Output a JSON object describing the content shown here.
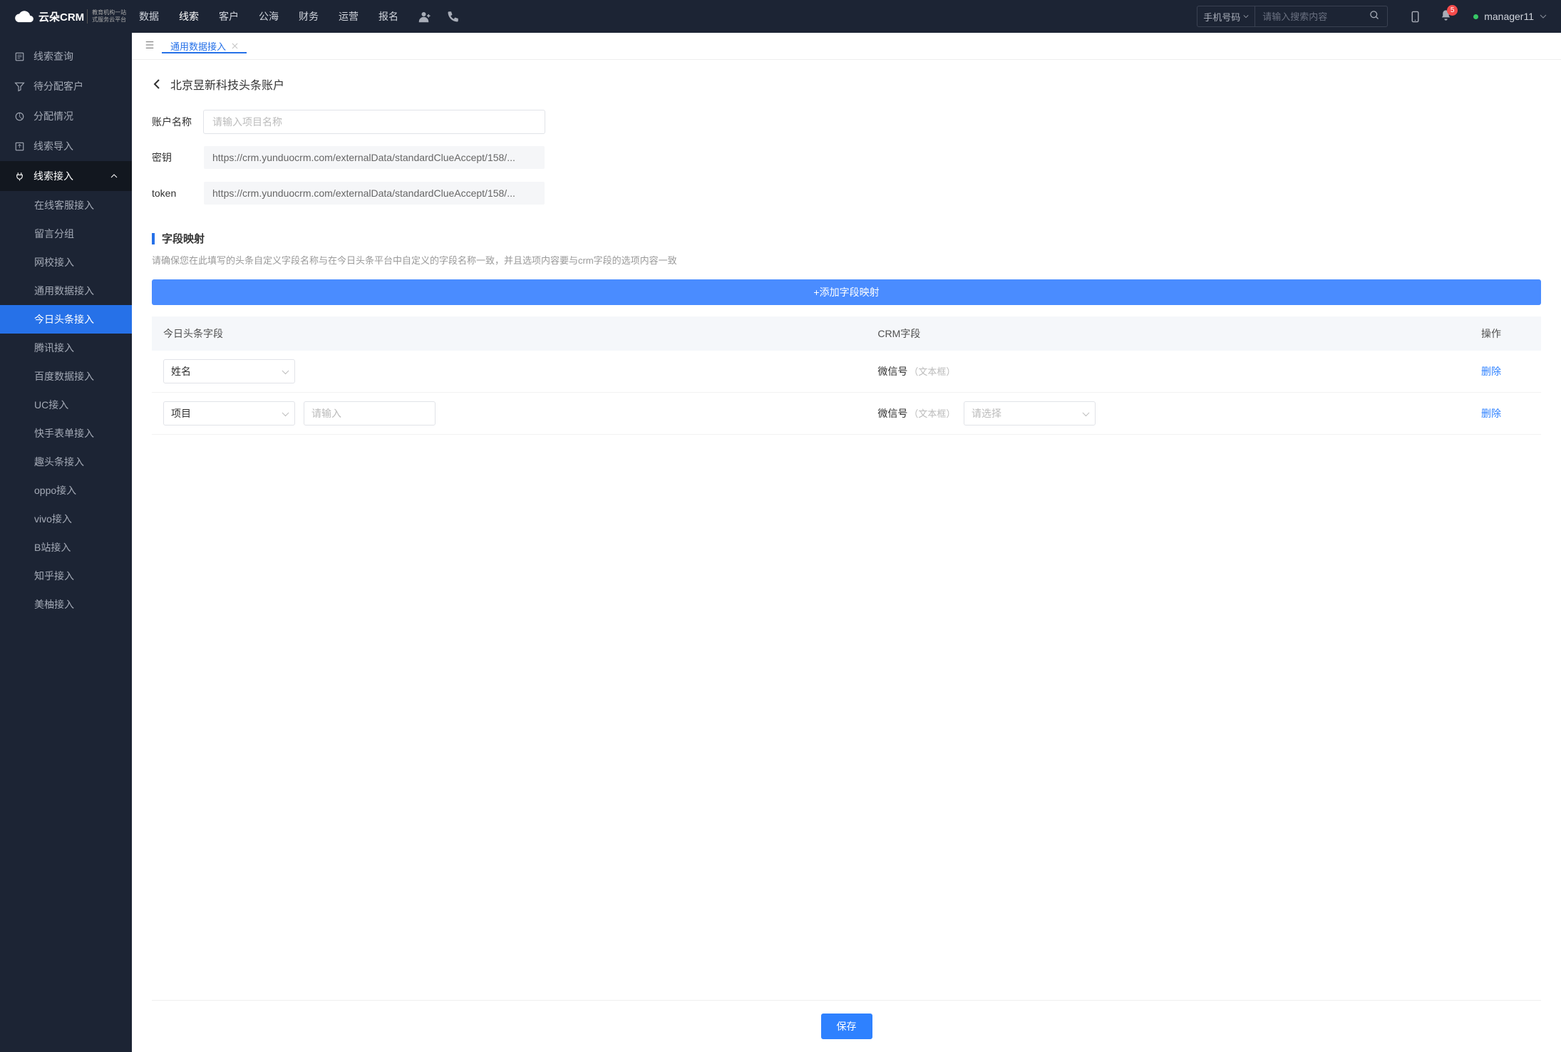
{
  "logo": {
    "brand": "云朵CRM",
    "sub1": "教育机构一站",
    "sub2": "式服务云平台"
  },
  "topNav": [
    "数据",
    "线索",
    "客户",
    "公海",
    "财务",
    "运营",
    "报名"
  ],
  "topNavActiveIndex": 1,
  "search": {
    "type": "手机号码",
    "placeholder": "请输入搜索内容"
  },
  "notifications": {
    "count": "5"
  },
  "user": {
    "name": "manager11"
  },
  "sidebar": {
    "items": [
      {
        "icon": "doc",
        "label": "线索查询"
      },
      {
        "icon": "filter",
        "label": "待分配客户"
      },
      {
        "icon": "pie",
        "label": "分配情况"
      },
      {
        "icon": "upload",
        "label": "线索导入"
      }
    ],
    "expanded": {
      "icon": "plug",
      "label": "线索接入"
    },
    "subItems": [
      "在线客服接入",
      "留言分组",
      "网校接入",
      "通用数据接入",
      "今日头条接入",
      "腾讯接入",
      "百度数据接入",
      "UC接入",
      "快手表单接入",
      "趣头条接入",
      "oppo接入",
      "vivo接入",
      "B站接入",
      "知乎接入",
      "美柚接入"
    ],
    "subActiveIndex": 4
  },
  "tabs": [
    {
      "label": "通用数据接入"
    }
  ],
  "tabActiveIndex": 0,
  "page": {
    "title": "北京昱新科技头条账户",
    "form": {
      "accountLabel": "账户名称",
      "accountPlaceholder": "请输入项目名称",
      "keyLabel": "密钥",
      "keyValue": "https://crm.yunduocrm.com/externalData/standardClueAccept/158/...",
      "tokenLabel": "token",
      "tokenValue": "https://crm.yunduocrm.com/externalData/standardClueAccept/158/..."
    },
    "mapping": {
      "title": "字段映射",
      "hint": "请确保您在此填写的头条自定义字段名称与在今日头条平台中自定义的字段名称一致，并且选项内容要与crm字段的选项内容一致",
      "addButton": "+添加字段映射",
      "headers": [
        "今日头条字段",
        "CRM字段",
        "操作"
      ],
      "rows": [
        {
          "field": "姓名",
          "crmField": "微信号",
          "crmType": "（文本框）",
          "action": "删除"
        },
        {
          "field": "项目",
          "extraInput": true,
          "extraPlaceholder": "请输入",
          "crmField": "微信号",
          "crmType": "（文本框）",
          "crmSelect": true,
          "crmSelectPlaceholder": "请选择",
          "action": "删除"
        }
      ]
    },
    "saveButton": "保存"
  }
}
